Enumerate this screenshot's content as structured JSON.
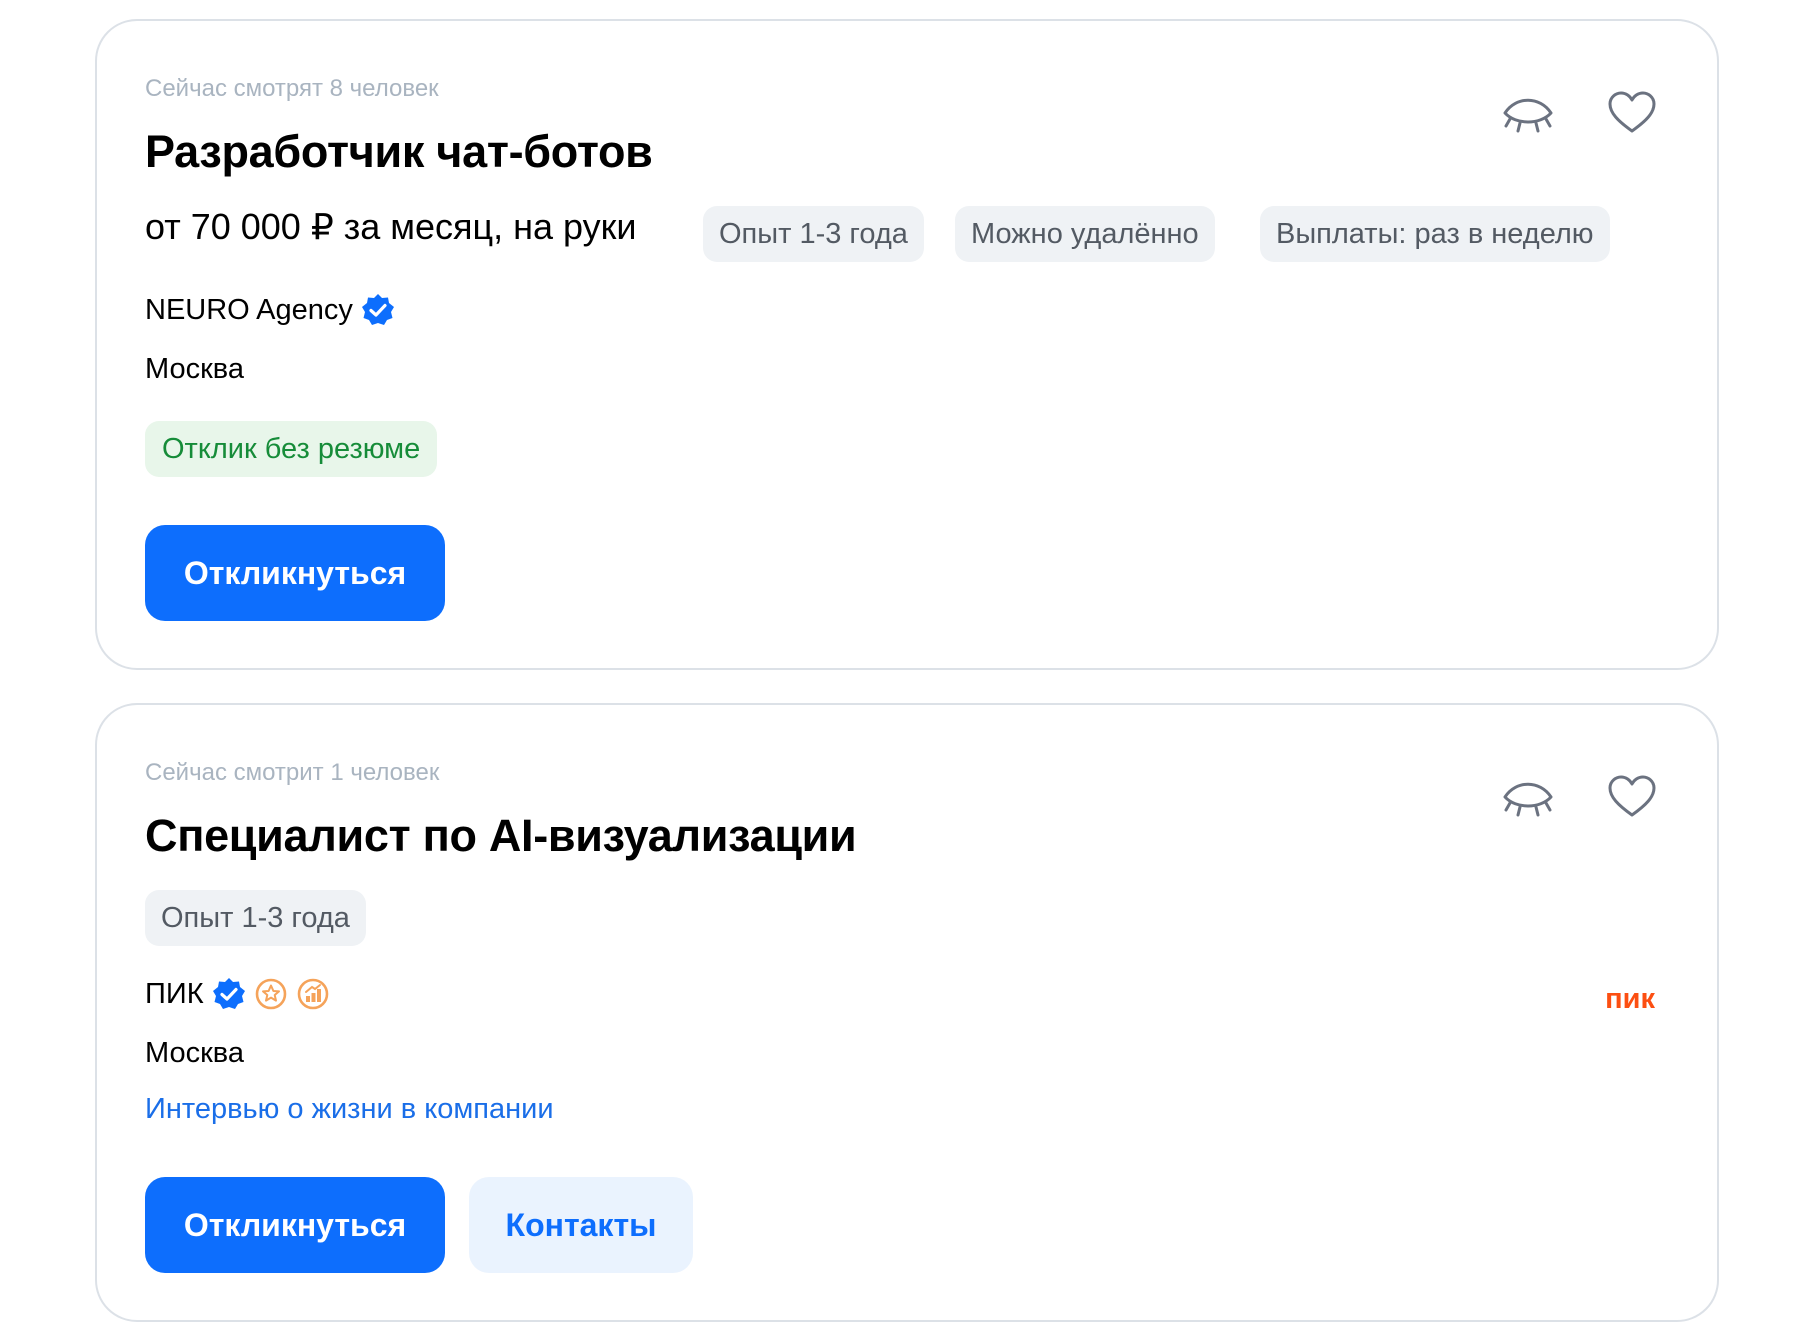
{
  "vacancies": [
    {
      "watchers": "Сейчас смотрят 8 человек",
      "title": "Разработчик чат-ботов",
      "salary": "от 70 000 ₽ за месяц, на руки",
      "tags": [
        "Опыт 1-3 года",
        "Можно удалённо",
        "Выплаты: раз в неделю"
      ],
      "company": "NEURO Agency",
      "city": "Москва",
      "response_badge": "Отклик без резюме",
      "apply_label": "Откликнуться",
      "icons": [
        "hide-eye-icon",
        "heart-icon",
        "verified-badge-icon"
      ]
    },
    {
      "watchers": "Сейчас смотрит 1 человек",
      "title": "Специалист по AI-визуализации",
      "tags": [
        "Опыт 1-3 года"
      ],
      "company": "ПИК",
      "city": "Москва",
      "company_link": "Интервью о жизни в компании",
      "apply_label": "Откликнуться",
      "contacts_label": "Контакты",
      "logo_text": "пик",
      "icons": [
        "hide-eye-icon",
        "heart-icon",
        "verified-badge-icon",
        "star-award-icon",
        "growth-award-icon"
      ]
    }
  ],
  "colors": {
    "primary": "#0d6efd",
    "muted_text": "#a9b4c0",
    "tag_bg": "#eff2f5",
    "green_text": "#168c39",
    "green_bg": "#e8f6ea",
    "award_orange": "#f5a35a",
    "pik_brand": "#fc4f12",
    "link": "#1a6ee8",
    "border": "#dce1e7"
  }
}
